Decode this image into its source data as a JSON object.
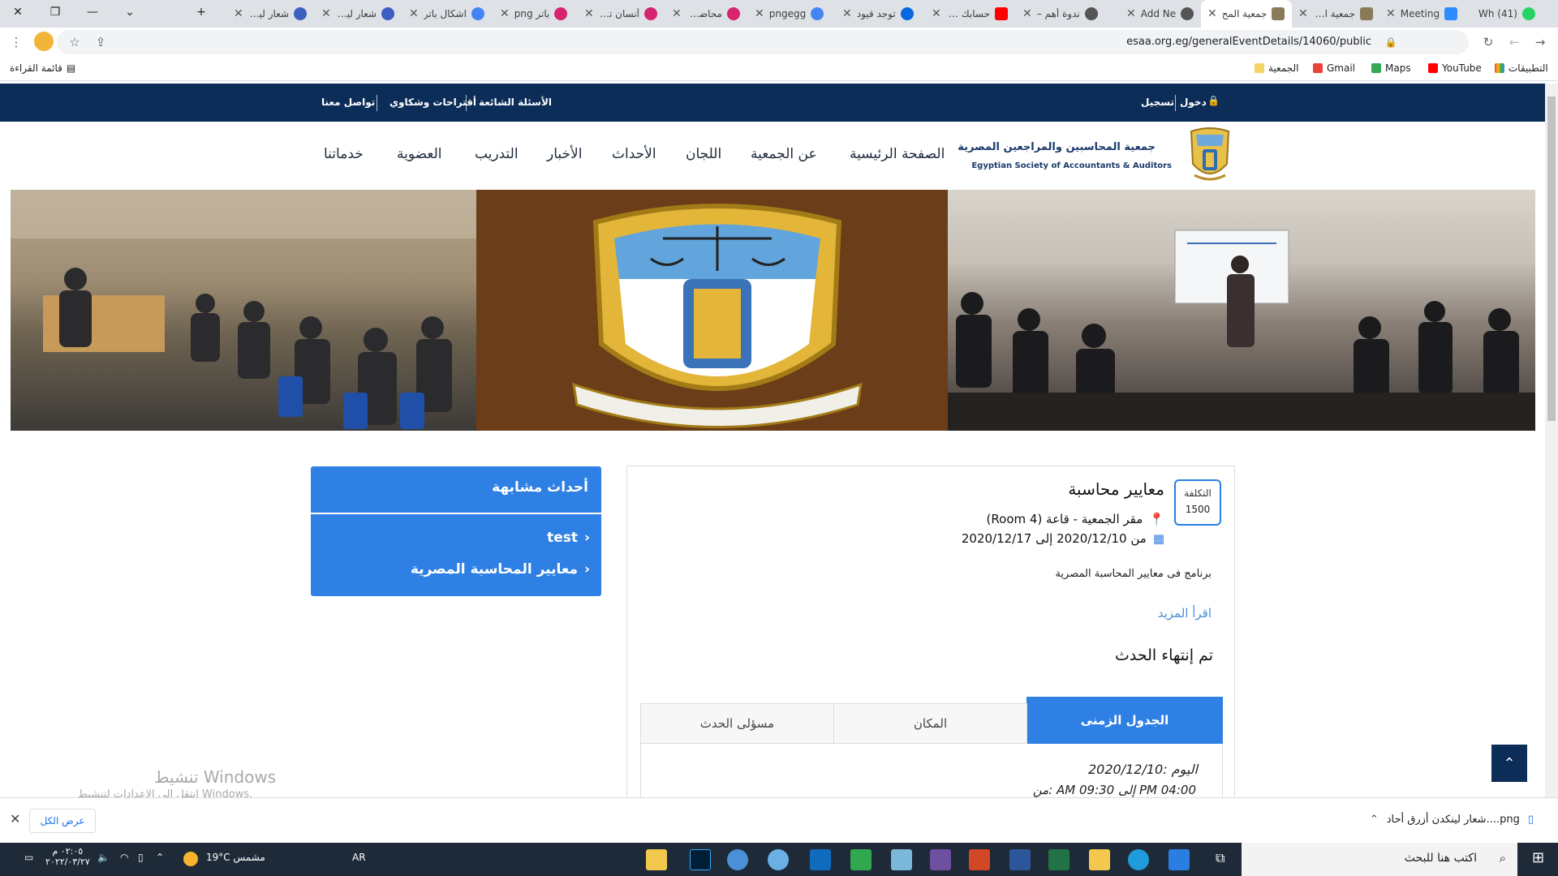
{
  "browser": {
    "tabs": [
      {
        "title": "(41) Wh"
      },
      {
        "title": "Meeting"
      },
      {
        "title": "جمعية المح"
      },
      {
        "title": "جمعية المح"
      },
      {
        "title": "Add Ne"
      },
      {
        "title": "ندوة أهم –"
      },
      {
        "title": "حسابك الأت"
      },
      {
        "title": "توجد قيود"
      },
      {
        "title": "pngegg"
      },
      {
        "title": "محاضرات"
      },
      {
        "title": "أنسان تقني"
      },
      {
        "title": "باتر png"
      },
      {
        "title": "اشكال باتر"
      },
      {
        "title": "شعار لينكد"
      },
      {
        "title": "شعار لينكد"
      }
    ],
    "url": "esaa.org.eg/generalEventDetails/14060/public",
    "bookmarks": {
      "apps": "التطبيقات",
      "youtube": "YouTube",
      "maps": "Maps",
      "gmail": "Gmail",
      "society": "الجمعية",
      "reading_list": "قائمة القراءة"
    }
  },
  "site": {
    "topbar": {
      "login": "دخول",
      "register": "تسجيل",
      "faq": "الأسئلة الشائعة",
      "suggestions": "أقتراحات وشكاوي",
      "contact": "تواصل معنا"
    },
    "logo": {
      "arabic": "جمعية المحاسبين والمراجعين المصرية",
      "english": "Egyptian Society of Accountants & Auditors"
    },
    "nav": [
      "الصفحة الرئيسية",
      "عن الجمعية",
      "اللجان",
      "الأحداث",
      "الأخبار",
      "التدريب",
      "العضوية",
      "خدماتنا"
    ]
  },
  "event": {
    "cost_label": "التكلفة",
    "cost_value": "1500",
    "title": "معايير محاسبة",
    "location": "مقر الجمعية - قاعة (Room 4)",
    "dates": "من 2020/12/10 إلى 2020/12/17",
    "description": "برنامج فى معايير المحاسبة المصرية",
    "read_more": "اقرأ المزيد",
    "status": "تم إنتهاء الحدث",
    "tabs": [
      "الجدول الزمنى",
      "المكان",
      "مسؤلى الحدث"
    ],
    "schedule_day": "اليوم :2020/12/10",
    "schedule_time": "من: AM 09:30 إلى PM 04:00"
  },
  "similar": {
    "heading": "أحداث مشابهة",
    "items": [
      "test",
      "معايير المحاسبة المصرية"
    ]
  },
  "windows": {
    "activate_title": "تنشيط Windows",
    "activate_sub": "انتقل إلى الإعدادات لتنشيط Windows.",
    "search_placeholder": "اكتب هنا للبحث",
    "weather": "19°C مشمس",
    "lang": "AR",
    "time": "٠٢:٠٥ م",
    "date": "٢٠٢٢/٠٣/٢٧"
  },
  "download": {
    "show_all": "عرض الكل",
    "file": "شعار لينكدن أزرق أحاد....png"
  }
}
